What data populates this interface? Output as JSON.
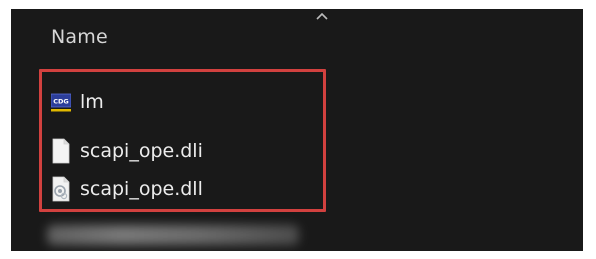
{
  "explorer": {
    "column_header": "Name",
    "sort_indicator_icon": "chevron-up-icon",
    "files": [
      {
        "name": "lm",
        "icon": "cdg-app-icon"
      },
      {
        "name": "scapi_ope.dli",
        "icon": "blank-file-icon"
      },
      {
        "name": "scapi_ope.dll",
        "icon": "dll-file-icon"
      }
    ],
    "highlight_color": "#d2413f"
  }
}
